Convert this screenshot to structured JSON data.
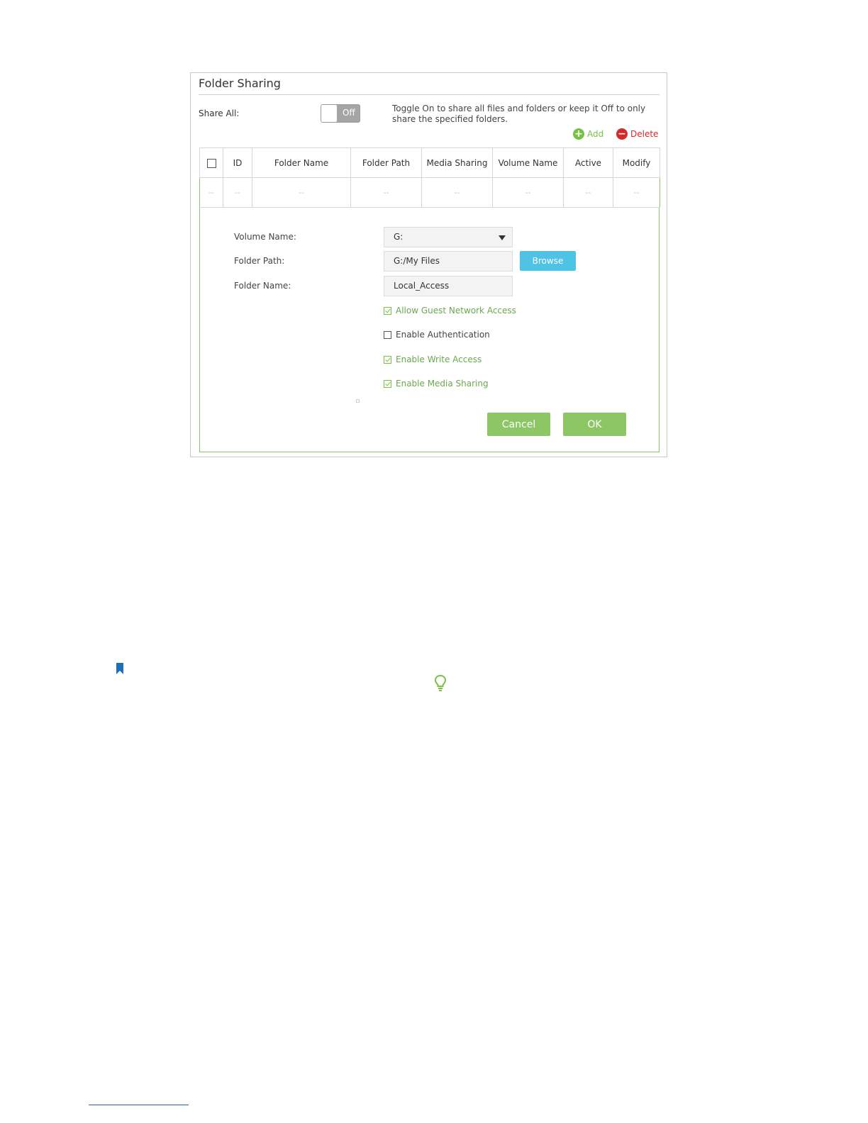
{
  "panel": {
    "title": "Folder Sharing",
    "share_all_label": "Share All:",
    "toggle_state": "Off",
    "toggle_hint": "Toggle On to share all files and folders or keep it Off to only share the specified folders.",
    "add_label": "Add",
    "delete_label": "Delete"
  },
  "table": {
    "columns": [
      "ID",
      "Folder Name",
      "Folder Path",
      "Media Sharing",
      "Volume Name",
      "Active",
      "Modify"
    ],
    "empty_row": [
      "--",
      "--",
      "--",
      "--",
      "--",
      "--",
      "--",
      "--"
    ]
  },
  "form": {
    "volume_label": "Volume Name:",
    "volume_value": "G:",
    "path_label": "Folder Path:",
    "path_value": "G:/My Files",
    "name_label": "Folder Name:",
    "name_value": "Local_Access",
    "browse_label": "Browse",
    "options": [
      {
        "label": "Allow Guest Network Access",
        "checked": true
      },
      {
        "label": "Enable Authentication",
        "checked": false
      },
      {
        "label": "Enable Write Access",
        "checked": true
      },
      {
        "label": "Enable Media Sharing",
        "checked": true
      }
    ],
    "cancel_label": "Cancel",
    "ok_label": "OK"
  },
  "colors": {
    "accent_green": "#7ac143",
    "button_green": "#8cc665",
    "browse_blue": "#4fc3e6",
    "delete_red": "#d42a2a"
  }
}
